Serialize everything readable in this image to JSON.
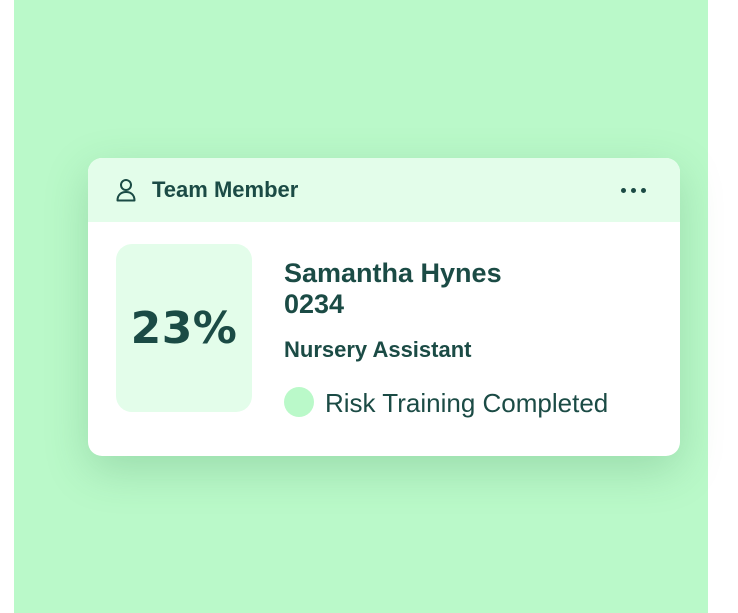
{
  "card": {
    "header_title": "Team Member",
    "header_icon": "person-icon",
    "menu_icon": "more-horizontal-icon",
    "progress_percent": "23%",
    "name": "Samantha Hynes",
    "member_id": "0234",
    "role": "Nursery Assistant",
    "status_text": "Risk Training Completed"
  },
  "colors": {
    "background": "#baf9c9",
    "header_background": "#e3fdea",
    "text": "#1b4b45",
    "status_dot": "#baf9c9",
    "card_background": "#ffffff"
  }
}
